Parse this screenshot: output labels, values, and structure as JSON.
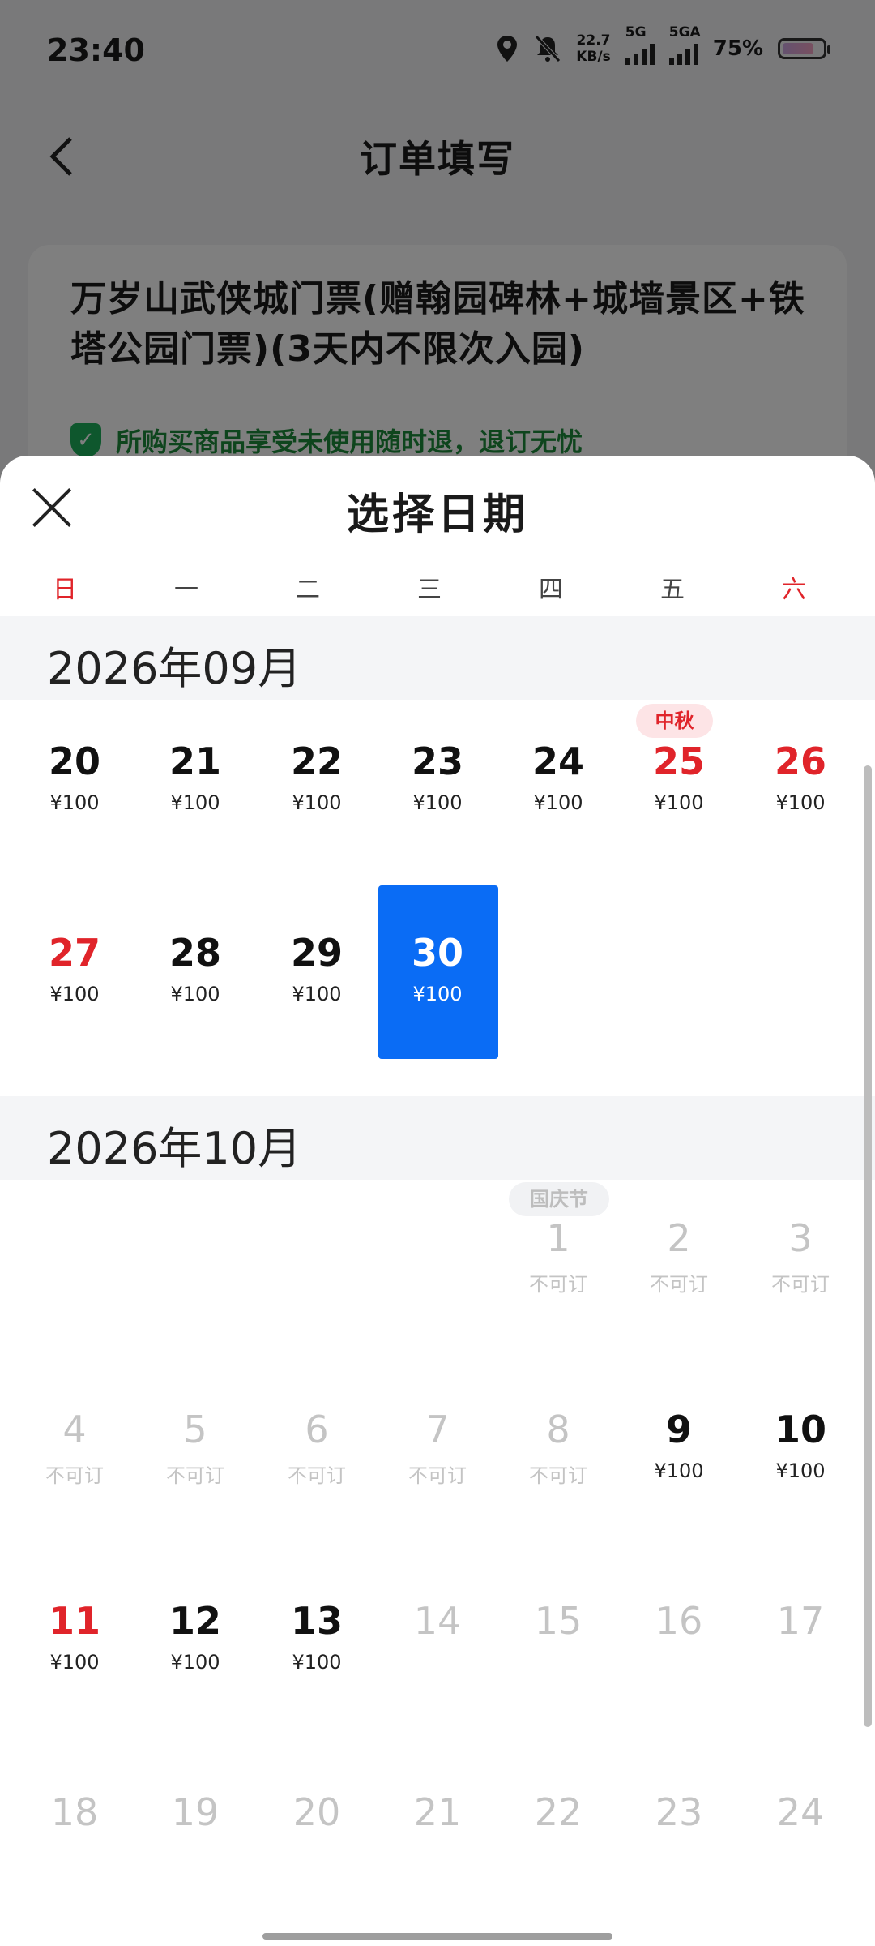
{
  "status_bar": {
    "time": "23:40",
    "net_speed": "22.7",
    "net_unit": "KB/s",
    "signal_1": "5G",
    "signal_2": "5GA",
    "battery": "75%",
    "icons": [
      "location-icon",
      "mute-bell-icon"
    ]
  },
  "nav": {
    "back_icon": "back-chevron-icon",
    "title": "订单填写"
  },
  "product": {
    "title": "万岁山武侠城门票(赠翰园碑林+城墙景区+铁塔公园门票)(3天内不限次入园)",
    "guarantee": "所购买商品享受未使用随时退，退订无忧"
  },
  "date_sheet": {
    "title": "选择日期",
    "close_icon": "close-icon",
    "weekdays": [
      "日",
      "一",
      "二",
      "三",
      "四",
      "五",
      "六"
    ],
    "weekend_color": "#e0242a",
    "selected_color": "#0a6cf5",
    "months": [
      {
        "label": "2026年09月",
        "days": [
          {
            "day": "20",
            "price": "¥100",
            "status": "available",
            "holiday": true
          },
          {
            "day": "21",
            "price": "¥100",
            "status": "available"
          },
          {
            "day": "22",
            "price": "¥100",
            "status": "available"
          },
          {
            "day": "23",
            "price": "¥100",
            "status": "available"
          },
          {
            "day": "24",
            "price": "¥100",
            "status": "available"
          },
          {
            "day": "25",
            "price": "¥100",
            "status": "available",
            "holiday": true,
            "festival": "中秋"
          },
          {
            "day": "26",
            "price": "¥100",
            "status": "available",
            "holiday": true
          },
          {
            "day": "27",
            "price": "¥100",
            "status": "available",
            "holiday": true,
            "red": true
          },
          {
            "day": "28",
            "price": "¥100",
            "status": "available"
          },
          {
            "day": "29",
            "price": "¥100",
            "status": "available"
          },
          {
            "day": "30",
            "price": "¥100",
            "status": "selected"
          }
        ]
      },
      {
        "label": "2026年10月",
        "days": [
          {
            "day": "1",
            "price": "不可订",
            "status": "unavailable",
            "festival": "国庆节"
          },
          {
            "day": "2",
            "price": "不可订",
            "status": "unavailable"
          },
          {
            "day": "3",
            "price": "不可订",
            "status": "unavailable"
          },
          {
            "day": "4",
            "price": "不可订",
            "status": "unavailable"
          },
          {
            "day": "5",
            "price": "不可订",
            "status": "unavailable"
          },
          {
            "day": "6",
            "price": "不可订",
            "status": "unavailable"
          },
          {
            "day": "7",
            "price": "不可订",
            "status": "unavailable"
          },
          {
            "day": "8",
            "price": "不可订",
            "status": "unavailable"
          },
          {
            "day": "9",
            "price": "¥100",
            "status": "available"
          },
          {
            "day": "10",
            "price": "¥100",
            "status": "available"
          },
          {
            "day": "11",
            "price": "¥100",
            "status": "available",
            "red": true
          },
          {
            "day": "12",
            "price": "¥100",
            "status": "available"
          },
          {
            "day": "13",
            "price": "¥100",
            "status": "available"
          },
          {
            "day": "14",
            "price": "",
            "status": "disabled"
          },
          {
            "day": "15",
            "price": "",
            "status": "disabled"
          },
          {
            "day": "16",
            "price": "",
            "status": "disabled"
          },
          {
            "day": "17",
            "price": "",
            "status": "disabled"
          },
          {
            "day": "18",
            "price": "",
            "status": "disabled"
          },
          {
            "day": "19",
            "price": "",
            "status": "disabled"
          },
          {
            "day": "20",
            "price": "",
            "status": "disabled"
          },
          {
            "day": "21",
            "price": "",
            "status": "disabled"
          },
          {
            "day": "22",
            "price": "",
            "status": "disabled"
          },
          {
            "day": "23",
            "price": "",
            "status": "disabled"
          },
          {
            "day": "24",
            "price": "",
            "status": "disabled"
          }
        ]
      }
    ]
  }
}
